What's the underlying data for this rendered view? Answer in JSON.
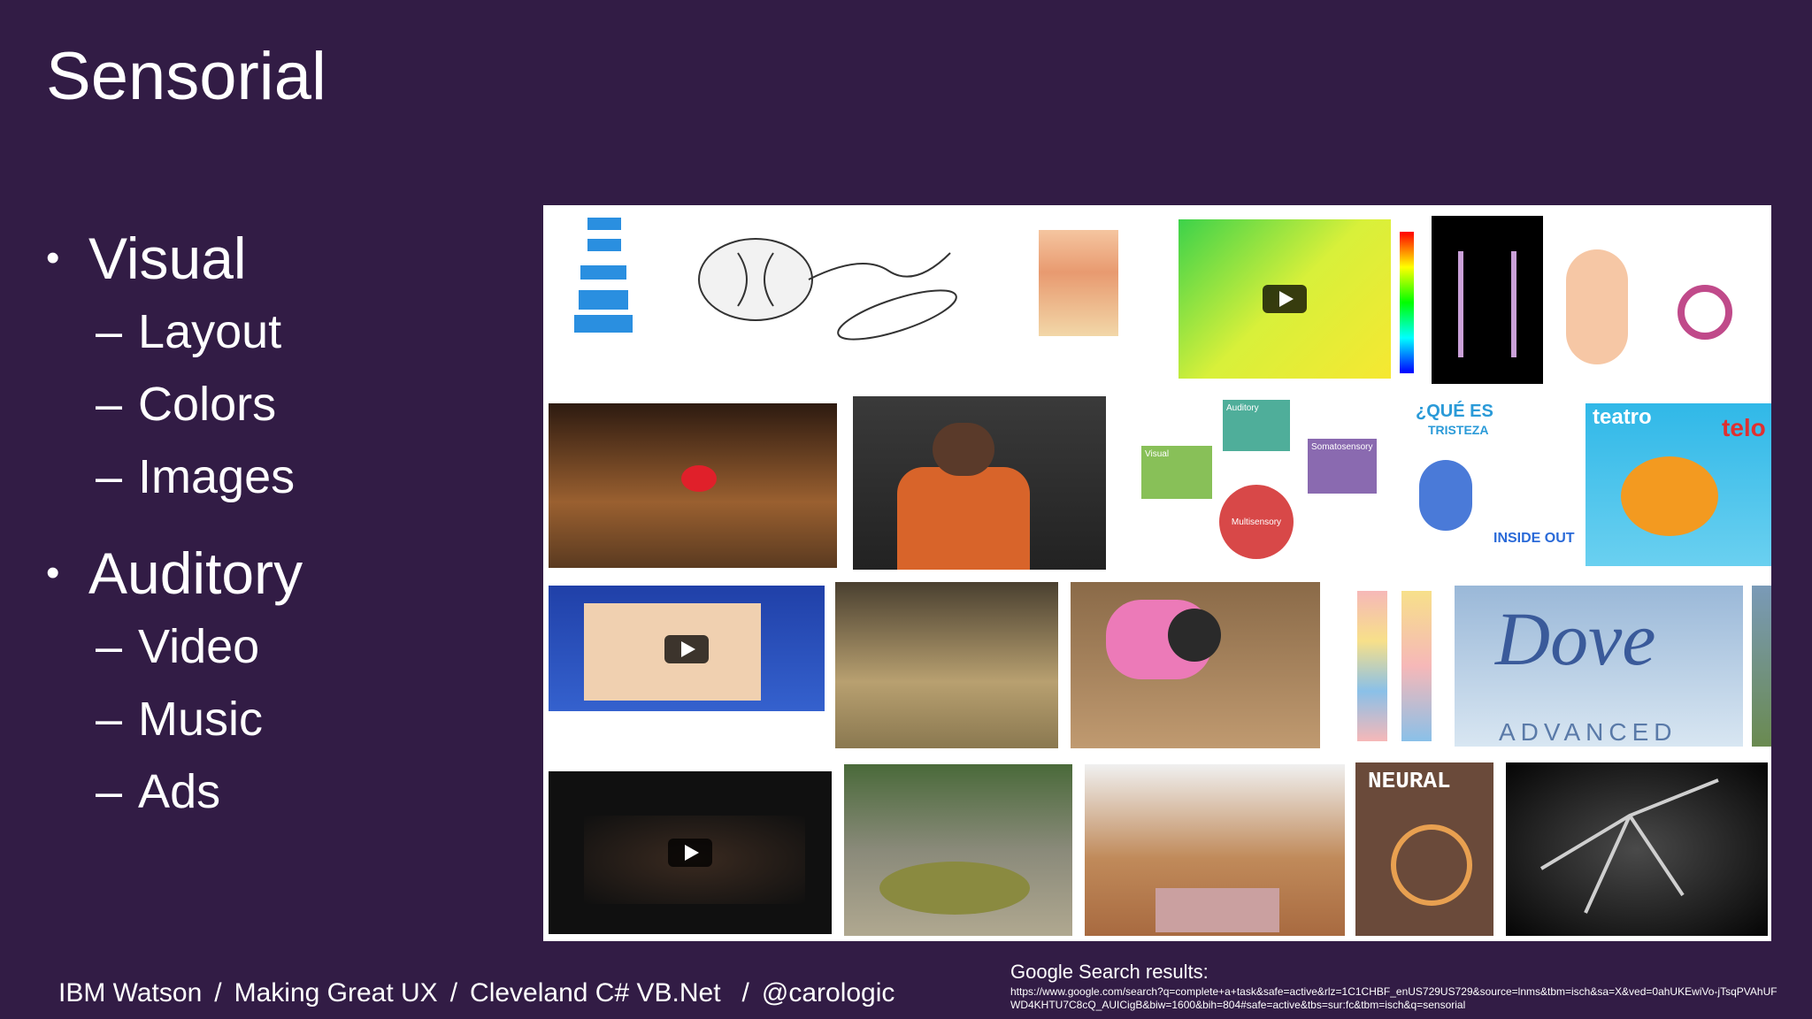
{
  "slide": {
    "title": "Sensorial"
  },
  "bullets": [
    {
      "label": "Visual",
      "items": [
        "Layout",
        "Colors",
        "Images"
      ]
    },
    {
      "label": "Auditory",
      "items": [
        "Video",
        "Music",
        "Ads"
      ]
    }
  ],
  "bullet_symbol": "•",
  "sub_symbol": "–",
  "collage": {
    "texts": {
      "que_es": "¿QUÉ ES",
      "tristeza": "TRISTEZA",
      "inside_out": "INSIDE OUT",
      "teatro": "teatro",
      "telon": "telo",
      "dove": "Dove",
      "advanced": "ADVANCED",
      "neural": "NEURAL",
      "auditory": "Auditory",
      "visual": "Visual",
      "somatosensory": "Somatosensory",
      "multisensory": "Multisensory"
    }
  },
  "footer": {
    "parts": [
      "IBM Watson",
      "Making Great UX",
      "Cleveland C# VB.Net",
      "@carologic"
    ],
    "separator": "/"
  },
  "source": {
    "title": "Google Search results:",
    "url": "https://www.google.com/search?q=complete+a+task&safe=active&rlz=1C1CHBF_enUS729US729&source=lnms&tbm=isch&sa=X&ved=0ahUKEwiVo-jTsqPVAhUFWD4KHTU7C8cQ_AUICigB&biw=1600&bih=804#safe=active&tbs=sur:fc&tbm=isch&q=sensorial"
  },
  "colors": {
    "background": "#321c45",
    "text": "#ffffff"
  }
}
